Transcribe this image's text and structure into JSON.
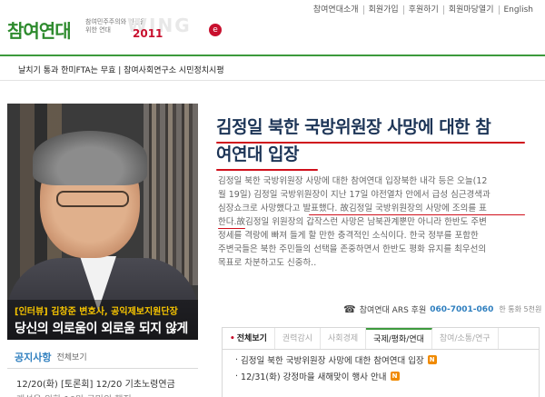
{
  "topnav": {
    "items": [
      "참여연대소개",
      "회원가입",
      "후원하기",
      "회원마당열기",
      "English"
    ]
  },
  "logo": {
    "name": "참여연대",
    "tagline": "참여민주주의와 인권을 위한 연대",
    "year": "2011",
    "year_bg": "WING",
    "badge": "e"
  },
  "breaking": {
    "text": "날치기 통과 한미FTA는 무효 | 참여사회연구소 시민정치시평"
  },
  "feature": {
    "caption_tag": "[인터뷰] 김창준 변호사, 공익제보지원단장",
    "caption_title": "당신의 의로움이 외로움 되지 않게"
  },
  "notice": {
    "title": "공지사항",
    "more": "전체보기",
    "items": [
      "12/20(화) [토론회] 12/20 기초노령연금",
      "개선을 위한 10만 국민의 행진"
    ]
  },
  "article": {
    "title_line1": "김정일 북한 국방위원장 사망에 대한 참",
    "title_line2": "여연대 입장",
    "body_lines": [
      "김정일 북한 국방위원장 사망에 대한  참여연대 입장북한 내각 등은 오늘(12",
      "월 19일) 김정일 국방위원장이 지난 17일 야전열차 안에서 급성 심근경색과",
      "심장쇼크로 사망했다고 발표했다. 故김정일 국방위원장의 사망에 조의를 표",
      "한다.故김정일 위원장의 갑작스런 사망은 남북관계뿐만 아니라 한반도 주변",
      "정세를 격랑에 빠져 들게 할 만한 충격적인 소식이다. 한국 정부를 포함한",
      "주변국들은 북한 주민들의 선택을 존중하면서 한반도 평화 유지를 최우선의",
      "목표로 차분하고도 신중하.."
    ]
  },
  "ars": {
    "label": "참여연대 ARS 후원",
    "number": "060-7001-060",
    "note": "한 통화 5천원"
  },
  "tabs": {
    "items": [
      "전체보기",
      "권력감시",
      "사회경제",
      "국제/평화/연대",
      "참여/소통/연구"
    ],
    "active_index": 3
  },
  "list": {
    "items": [
      "김정일 북한 국방위원장 사망에 대한 참여연대 입장",
      "12/31(화) 강정마을 새해맞이 행사 안내"
    ],
    "badge": "N"
  },
  "colors": {
    "brand_green": "#3c9a3c",
    "accent_red": "#c8102e",
    "title_navy": "#1d3557",
    "link_blue": "#2f7fbf"
  }
}
